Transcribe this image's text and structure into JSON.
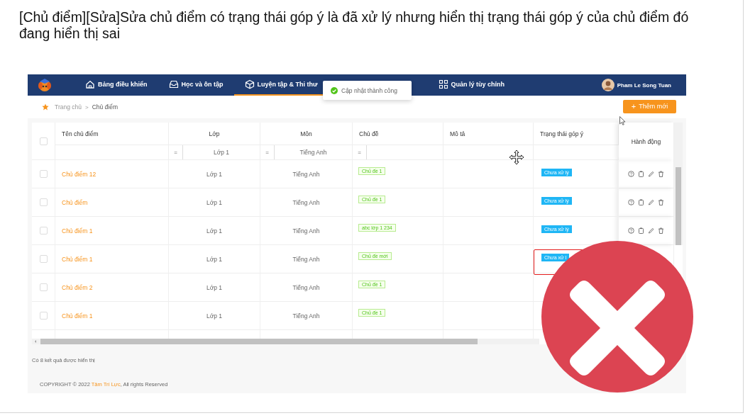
{
  "document": {
    "title": "[Chủ điểm][Sửa]Sửa chủ điểm có trạng thái góp ý là đã xử lý nhưng hiển thị trạng thái góp ý của chủ điểm đó đang hiển thị sai"
  },
  "app": {
    "nav": {
      "items": [
        {
          "label": "Bảng điều khiển",
          "selected": false
        },
        {
          "label": "Học và ôn tập",
          "selected": false
        },
        {
          "label": "Luyện tập & Thi thư",
          "selected": true
        },
        {
          "label": "Quản lý tùy chỉnh",
          "selected": false
        }
      ],
      "user": {
        "name": "Pham Le Song Tuan"
      }
    },
    "toast": {
      "message": "Cập nhật thành công"
    },
    "breadcrumb": [
      "Trang chủ",
      "Chủ điểm"
    ],
    "breadcrumb_separator": ">",
    "add_button": {
      "icon": "+",
      "label": "Thêm mới"
    },
    "table": {
      "columns": [
        {
          "label": "Tên chủ điểm"
        },
        {
          "label": "Lớp",
          "filter": {
            "operator": "=",
            "value": "Lớp 1"
          }
        },
        {
          "label": "Môn",
          "filter": {
            "operator": "=",
            "value": "Tiếng Anh"
          }
        },
        {
          "label": "Chủ đề",
          "filter": {
            "operator": "="
          }
        },
        {
          "label": "Mô tả"
        },
        {
          "label": "Trạng thái góp ý"
        }
      ],
      "actions_column": "Hành động",
      "header_checked": false,
      "rows": [
        {
          "checked": false,
          "name": "Chủ điểm 12",
          "grade": "Lớp 1",
          "subject": "Tiếng Anh",
          "topic": "Chủ đề 1",
          "status": "Chưa xử lý",
          "actions": true,
          "highlighted": false
        },
        {
          "checked": false,
          "name": "Chủ điểm",
          "grade": "Lớp 1",
          "subject": "Tiếng Anh",
          "topic": "Chủ đề 1",
          "status": "Chưa xử lý",
          "actions": true,
          "highlighted": false
        },
        {
          "checked": false,
          "name": "Chủ điểm 1",
          "grade": "Lớp 1",
          "subject": "Tiếng Anh",
          "topic": "abc lớp 1 234",
          "status": "Chưa xử lý",
          "actions": true,
          "highlighted": false
        },
        {
          "checked": false,
          "name": "Chủ điểm 1",
          "grade": "Lớp 1",
          "subject": "Tiếng Anh",
          "topic": "Chủ đề mới",
          "status": "Chưa xử l",
          "actions": false,
          "highlighted": true
        },
        {
          "checked": false,
          "name": "Chủ điểm 2",
          "grade": "Lớp 1",
          "subject": "Tiếng Anh",
          "topic": "Chủ đề 1",
          "highlighted": false
        },
        {
          "checked": false,
          "name": "Chủ điểm 1",
          "grade": "Lớp 1",
          "subject": "Tiếng Anh",
          "topic": "Chủ đề 1",
          "highlighted": false
        }
      ]
    },
    "result_count": "Có 8 kết quả được hiển thị",
    "footer": {
      "prefix": "COPYRIGHT © 2022 ",
      "brand": "Tâm Trí Lực",
      "suffix": ", All rights Reserved"
    }
  },
  "annotation": {
    "kind": "wrong"
  }
}
